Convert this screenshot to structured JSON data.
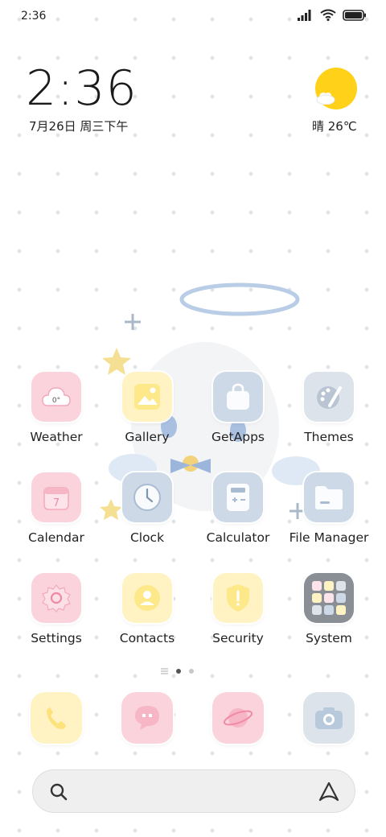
{
  "status_bar": {
    "time": "2:36",
    "icons": [
      "signal-icon",
      "wifi-icon",
      "battery-icon"
    ]
  },
  "clock_widget": {
    "time": "2:36",
    "date": "7月26日 周三下午"
  },
  "weather_widget": {
    "text": "晴 26℃",
    "icon": "sun-cloud-icon"
  },
  "apps": [
    {
      "label": "Weather",
      "icon": "weather-icon",
      "badge": "0°"
    },
    {
      "label": "Gallery",
      "icon": "gallery-icon"
    },
    {
      "label": "GetApps",
      "icon": "getapps-icon"
    },
    {
      "label": "Themes",
      "icon": "themes-icon"
    },
    {
      "label": "Calendar",
      "icon": "calendar-icon",
      "badge": "7"
    },
    {
      "label": "Clock",
      "icon": "clock-icon"
    },
    {
      "label": "Calculator",
      "icon": "calculator-icon"
    },
    {
      "label": "File Manager",
      "icon": "file-manager-icon"
    },
    {
      "label": "Settings",
      "icon": "settings-icon"
    },
    {
      "label": "Contacts",
      "icon": "contacts-icon"
    },
    {
      "label": "Security",
      "icon": "security-icon"
    },
    {
      "label": "System",
      "icon": "system-folder-icon"
    }
  ],
  "page_indicator": {
    "pages": 2,
    "active": 1
  },
  "dock": [
    "phone-icon",
    "messages-icon",
    "browser-icon",
    "camera-icon"
  ],
  "colors": {
    "pink": "#fbd3dd",
    "yellow": "#fff3c4",
    "blue": "#cdd9e6",
    "sun": "#ffd119"
  }
}
